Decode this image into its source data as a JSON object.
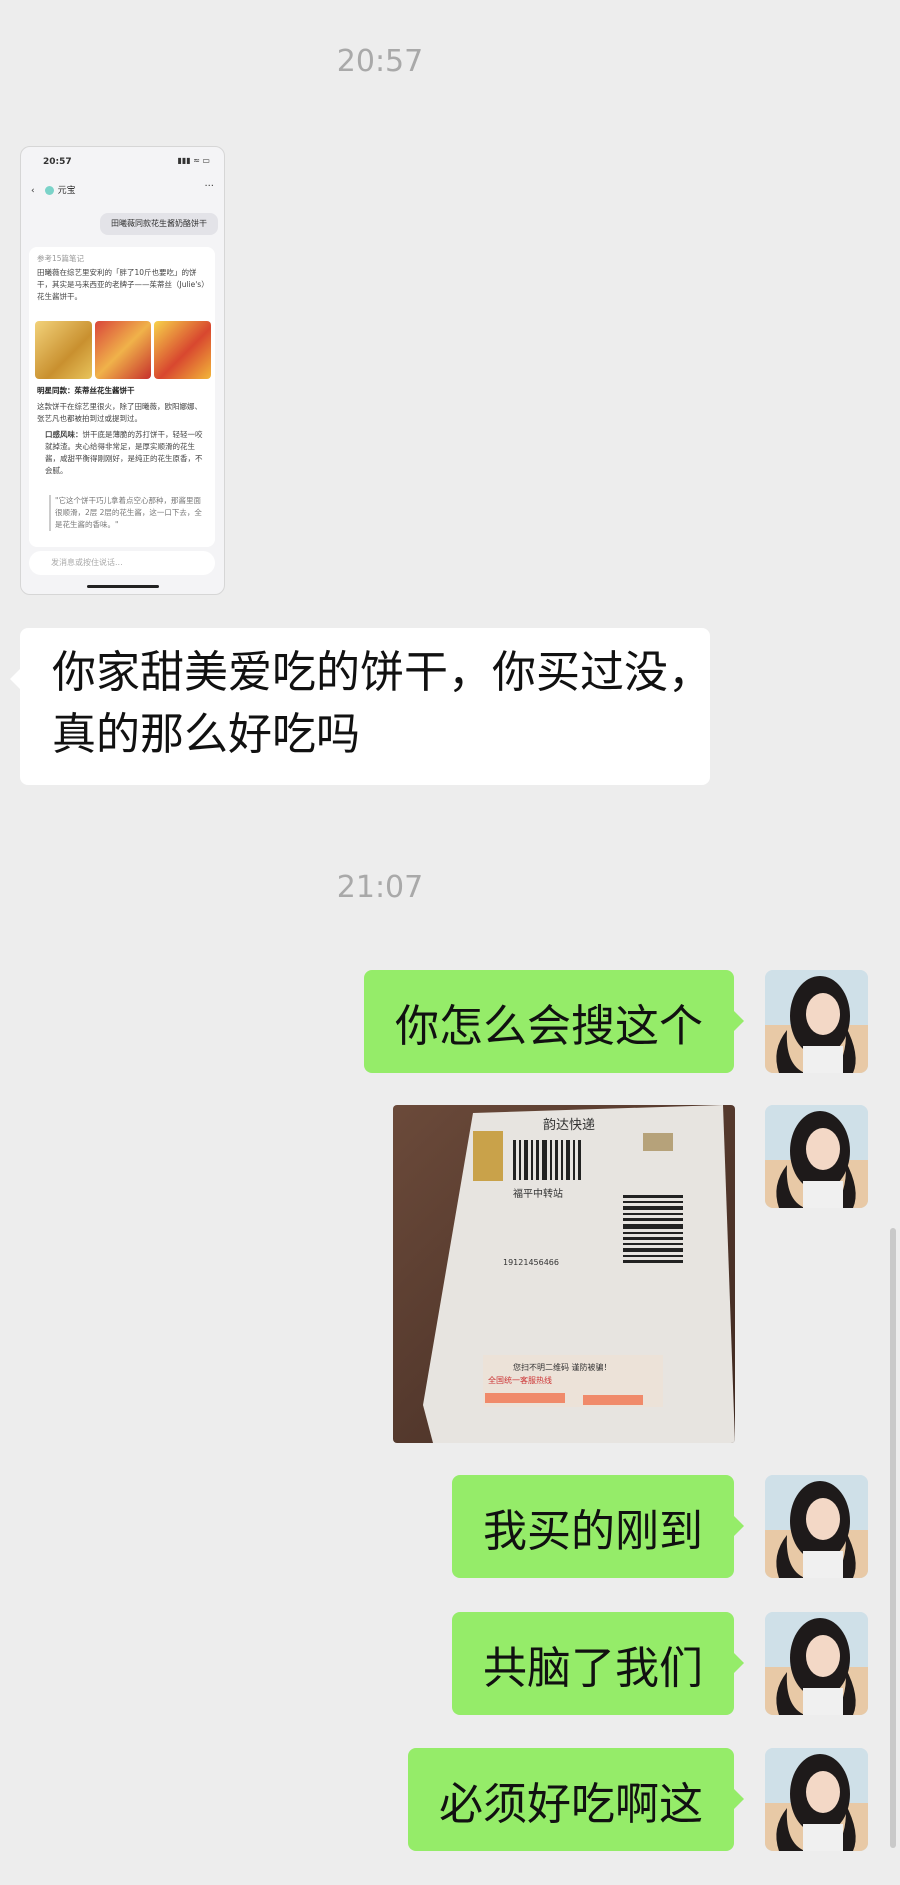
{
  "timestamps": [
    "20:57",
    "21:07"
  ],
  "thumbnail": {
    "status_time": "20:57",
    "status_icons": "▮▮▮ ≈ ▭",
    "back_icon": "‹",
    "app_title": "元宝",
    "more_icon": "···",
    "question": "田曦薇同款花生酱奶酪饼干",
    "ref_line": "参考15篇笔记",
    "answer_intro": "田曦薇在综艺里安利的「胖了10斤也要吃」的饼干，其实是马来西亚的老牌子——茱蒂丝（Julie's）花生酱饼干。",
    "section_title": "明星同款：茱蒂丝花生酱饼干",
    "para1": "这款饼干在综艺里很火，除了田曦薇，欧阳娜娜、张艺凡也都被拍到过或提到过。",
    "bullet_title": "口感风味：",
    "bullet_text": "饼干底是薄脆的苏打饼干，轻轻一咬就掉渣。夹心给得非常足，是厚实顺滑的花生酱，咸甜平衡得刚刚好，是纯正的花生原香，不会腻。",
    "quote": "\"它这个饼干巧儿拿着点空心那种，那酱里面很顺滑，2层 2层的花生酱，这一口下去，全是花生酱的香味。\"",
    "input_placeholder": "发消息或按住说话..."
  },
  "messages": [
    {
      "side": "left",
      "text_line1": "你家甜美爱吃的饼干，你买过没，",
      "text_line2": "真的那么好吃吗"
    },
    {
      "side": "right",
      "text": "你怎么会搜这个"
    },
    {
      "side": "right",
      "text": "我买的刚到"
    },
    {
      "side": "right",
      "text": "共脑了我们"
    },
    {
      "side": "right",
      "text": "必须好吃啊这"
    }
  ],
  "parcel_label": {
    "courier": "韵达快递",
    "line_area": "福平中转站",
    "tracking_fragment": "19121456466",
    "footer_red": "全国统一客服热线",
    "footer_note": "您扫不明二维码 谨防被骗！"
  },
  "colors": {
    "background": "#ededed",
    "green_bubble": "#95ec69",
    "white_bubble": "#ffffff",
    "timestamp": "#a9a9a9"
  }
}
